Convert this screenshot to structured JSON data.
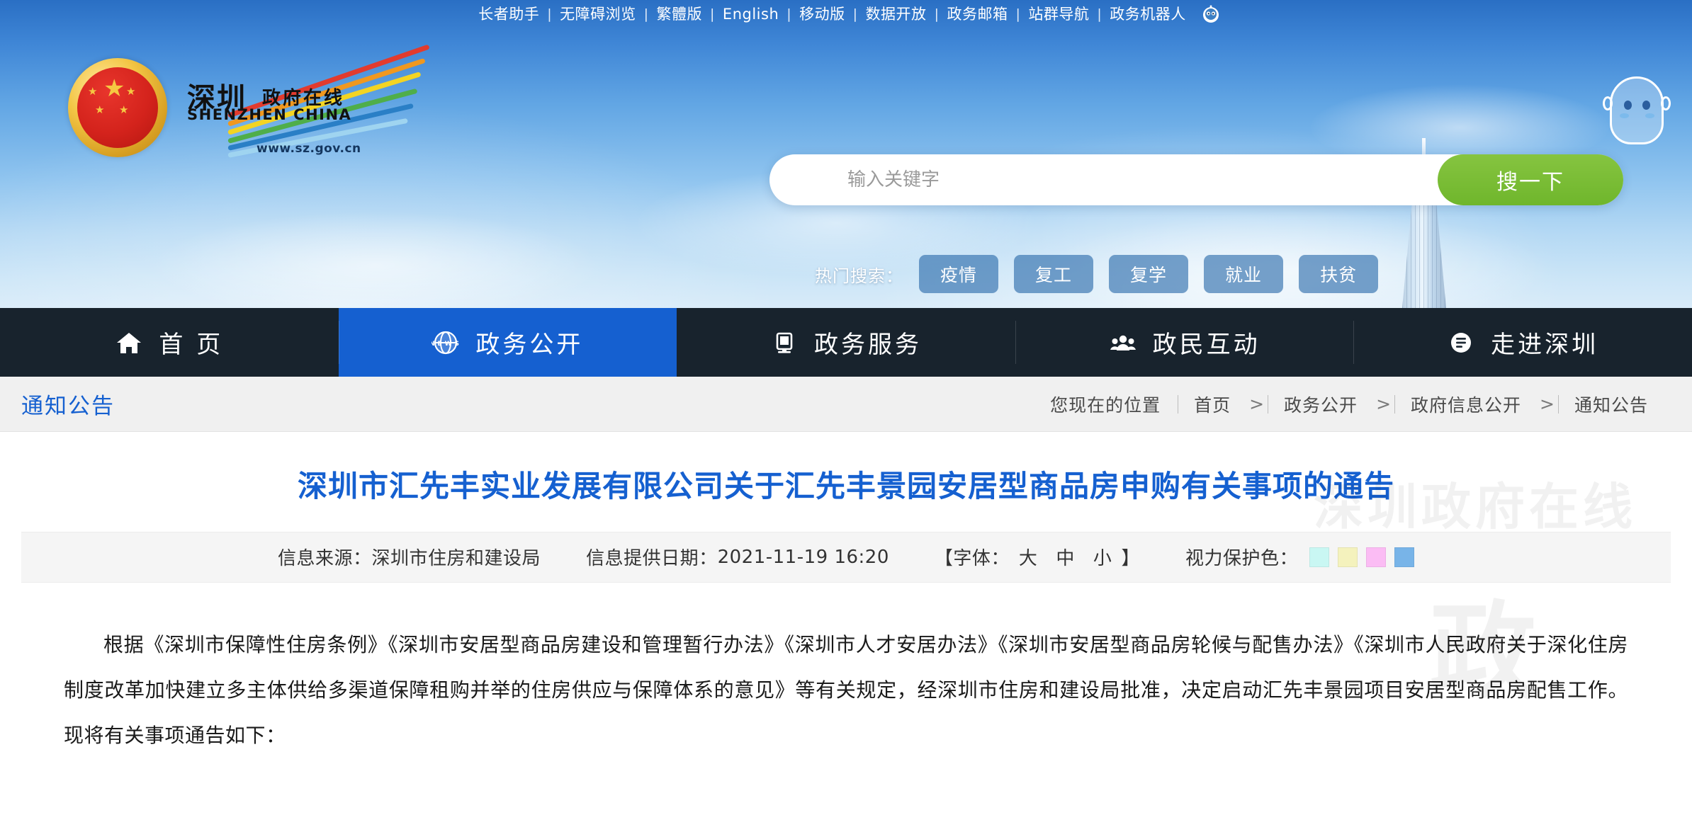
{
  "topbar": {
    "links": [
      {
        "label": "长者助手"
      },
      {
        "label": "无障碍浏览"
      },
      {
        "label": "繁體版"
      },
      {
        "label": "English"
      },
      {
        "label": "移动版"
      },
      {
        "label": "数据开放"
      },
      {
        "label": "政务邮箱"
      },
      {
        "label": "站群导航"
      },
      {
        "label": "政务机器人"
      }
    ],
    "separator": "|"
  },
  "brand": {
    "emblem_alt": "national-emblem",
    "zh_name": "深圳",
    "zh_sub": "政府在线",
    "en_name": "SHENZHEN  CHINA",
    "url": "www.sz.gov.cn"
  },
  "search": {
    "placeholder": "输入关键字",
    "value": "",
    "button_label": "搜一下",
    "hot_label": "热门搜索：",
    "hot_tags": [
      "疫情",
      "复工",
      "复学",
      "就业",
      "扶贫"
    ],
    "button_color": "#6fb62c"
  },
  "nav": {
    "items": [
      {
        "label": "首 页",
        "icon": "home-icon",
        "active": false
      },
      {
        "label": "政务公开",
        "icon": "news-globe-icon",
        "active": true
      },
      {
        "label": "政务服务",
        "icon": "monitor-icon",
        "active": false
      },
      {
        "label": "政民互动",
        "icon": "people-icon",
        "active": false
      },
      {
        "label": "走进深圳",
        "icon": "info-circle-icon",
        "active": false
      }
    ],
    "active_color": "#1560d0"
  },
  "breadcrumb": {
    "section_title": "通知公告",
    "position_label": "您现在的位置",
    "items": [
      "首页",
      "政务公开",
      "政府信息公开",
      "通知公告"
    ],
    "separator": ">"
  },
  "article": {
    "title": "深圳市汇先丰实业发展有限公司关于汇先丰景园安居型商品房申购有关事项的通告",
    "source_label": "信息来源：",
    "source_value": "深圳市住房和建设局",
    "date_label": "信息提供日期：",
    "date_value": "2021-11-19 16:20",
    "font_label_open": "【字体：",
    "font_label_close": "】",
    "font_sizes": [
      "大",
      "中",
      "小"
    ],
    "eye_color_label": "视力保护色：",
    "eye_colors": [
      "#c9f7f3",
      "#f4f2bd",
      "#fbbcf4",
      "#78b4e8"
    ],
    "body": "根据《深圳市保障性住房条例》《深圳市安居型商品房建设和管理暂行办法》《深圳市人才安居办法》《深圳市安居型商品房轮候与配售办法》《深圳市人民政府关于深化住房制度改革加快建立多主体供给多渠道保障租购并举的住房供应与保障体系的意见》等有关规定，经深圳市住房和建设局批准，决定启动汇先丰景园项目安居型商品房配售工作。现将有关事项通告如下："
  },
  "watermark": {
    "line1": "深圳政府在线",
    "line2": "政"
  }
}
